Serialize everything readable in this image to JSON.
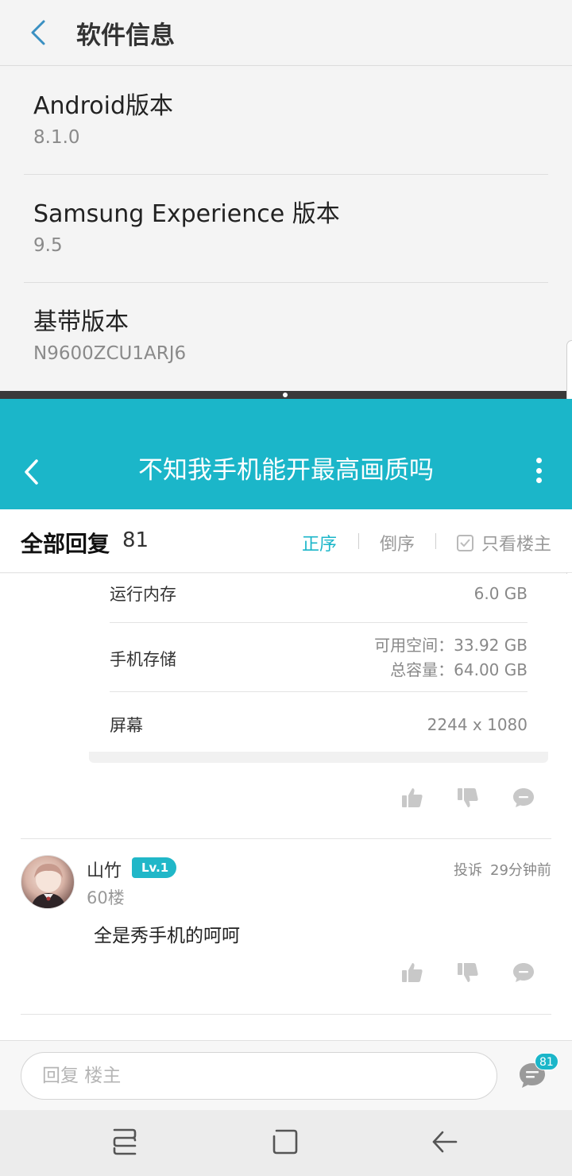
{
  "settings": {
    "title": "软件信息",
    "items": [
      {
        "label": "Android版本",
        "value": "8.1.0"
      },
      {
        "label": "Samsung Experience 版本",
        "value": "9.5"
      },
      {
        "label": "基带版本",
        "value": "N9600ZCU1ARJ6"
      }
    ]
  },
  "forum": {
    "title": "不知我手机能开最高画质吗",
    "reply_bar": {
      "all_label": "全部回复",
      "count": "81",
      "sort_asc": "正序",
      "sort_desc": "倒序",
      "only_op": "只看楼主"
    },
    "specs": [
      {
        "label": "运行内存",
        "value": "6.0 GB"
      },
      {
        "label": "手机存储",
        "value_line1": "可用空间：33.92  GB",
        "value_line2": "总容量：64.00  GB"
      },
      {
        "label": "屏幕",
        "value": "2244 x 1080"
      }
    ],
    "post": {
      "username": "山竹",
      "level": "Lv.1",
      "floor": "60楼",
      "report": "投诉",
      "time": "29分钟前",
      "text": "全是秀手机的呵呵"
    },
    "input": {
      "placeholder": "回复  楼主",
      "comment_count": "81"
    }
  },
  "colors": {
    "accent": "#1bb6c9",
    "icon_gray": "#c8c8c8"
  },
  "icons": {
    "like": "thumbs-up-icon",
    "dislike": "thumbs-down-icon",
    "comment": "comment-icon"
  }
}
